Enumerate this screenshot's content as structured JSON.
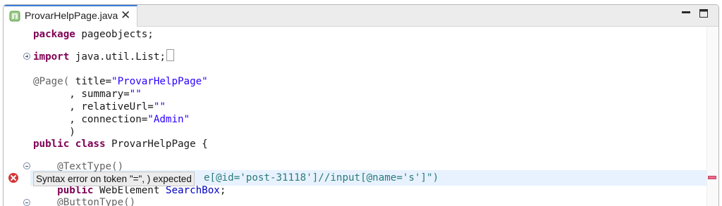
{
  "tab": {
    "title": "ProvarHelpPage.java",
    "close_glyph": "✕",
    "icon": "java-file-icon"
  },
  "window_controls": {
    "minimize": "minimize-icon",
    "maximize": "maximize-icon"
  },
  "code": {
    "line1": {
      "kw": "package",
      "rest": " pageobjects;"
    },
    "line2": {
      "kw": "import",
      "rest": " java.util.List;",
      "folded": "..."
    },
    "line3": {
      "ann": "@Page(",
      "attr": " title=",
      "val": "\"ProvarHelpPage\""
    },
    "line4": {
      "attr": "      , summary=",
      "val": "\"\""
    },
    "line5": {
      "attr": "      , relativeUrl=",
      "val": "\"\""
    },
    "line6": {
      "attr": "      , connection=",
      "val": "\"Admin\""
    },
    "line7": {
      "text": "      )"
    },
    "line8": {
      "kw1": "public",
      "kw2": "class",
      "rest": " ProvarHelpPage {"
    },
    "line9": {
      "ann": "    @TextType()"
    },
    "line10": {
      "xpath": "e[@id='post-31118']//input[@name='s']\")"
    },
    "line11": {
      "kw": "    public",
      "type": " WebElement",
      "field": " SearchBox",
      "rest": ";"
    },
    "line12": {
      "ann": "    @ButtonType()"
    }
  },
  "error": {
    "tooltip": "Syntax error on token \"=\", ) expected",
    "marker_color": "#d53434"
  },
  "colors": {
    "keyword": "#7f0055",
    "string": "#2a00ff",
    "annotation": "#646464",
    "field": "#0000c0",
    "current_line": "#e8f2fe"
  }
}
